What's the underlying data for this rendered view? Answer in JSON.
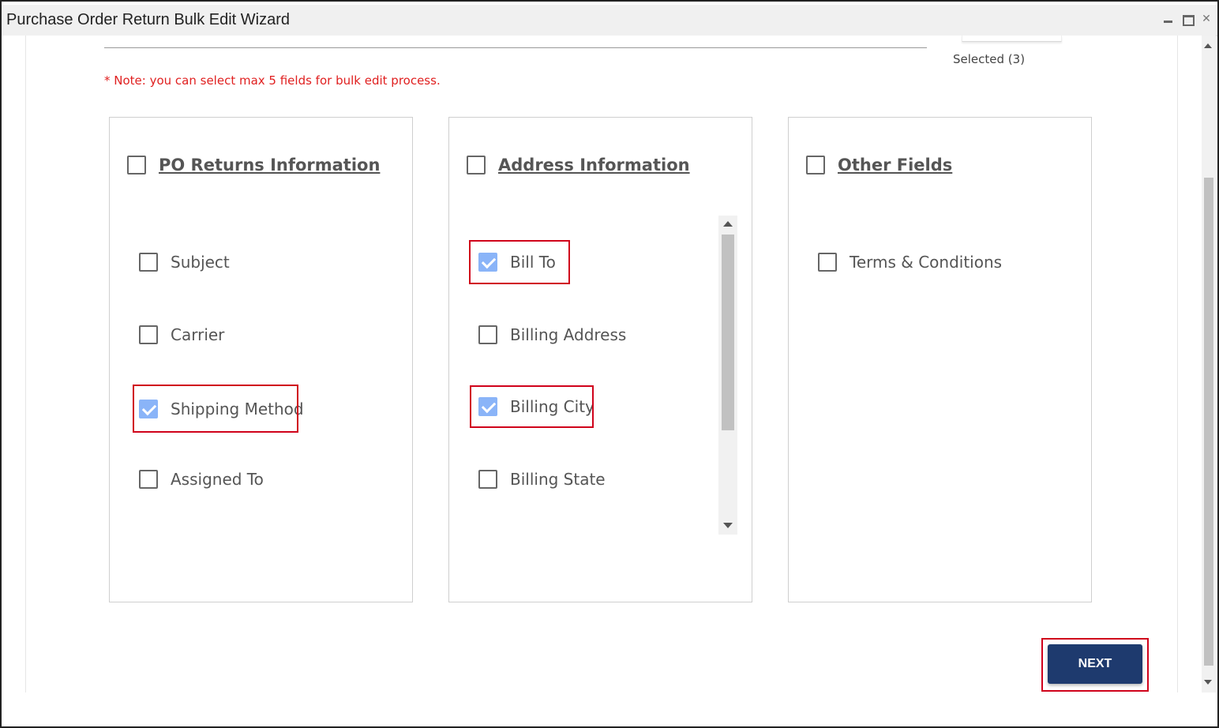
{
  "window": {
    "title": "Purchase Order Return Bulk Edit Wizard",
    "controls": [
      "minimize-icon",
      "maximize-icon",
      "close-icon"
    ],
    "close_glyph": "✕"
  },
  "header": {
    "selected_count": "Selected (3)"
  },
  "note": "* Note: you can select max 5 fields for bulk edit process.",
  "cards": [
    {
      "title": "PO Returns Information",
      "checked": false,
      "fields": [
        {
          "label": "Subject",
          "checked": false
        },
        {
          "label": "Carrier",
          "checked": false
        },
        {
          "label": "Shipping Method",
          "checked": true
        },
        {
          "label": "Assigned To",
          "checked": false
        }
      ]
    },
    {
      "title": "Address Information",
      "checked": false,
      "fields": [
        {
          "label": "Bill To",
          "checked": true
        },
        {
          "label": "Billing Address",
          "checked": false
        },
        {
          "label": "Billing City",
          "checked": true
        },
        {
          "label": "Billing State",
          "checked": false
        }
      ]
    },
    {
      "title": "Other Fields",
      "checked": false,
      "fields": [
        {
          "label": "Terms & Conditions",
          "checked": false
        }
      ]
    }
  ],
  "actions": {
    "next_label": "NEXT"
  },
  "colors": {
    "note": "#e02020",
    "checkbox_checked": "#8ab4f8",
    "primary_button": "#1e3a6e",
    "highlight": "#d0021b"
  }
}
